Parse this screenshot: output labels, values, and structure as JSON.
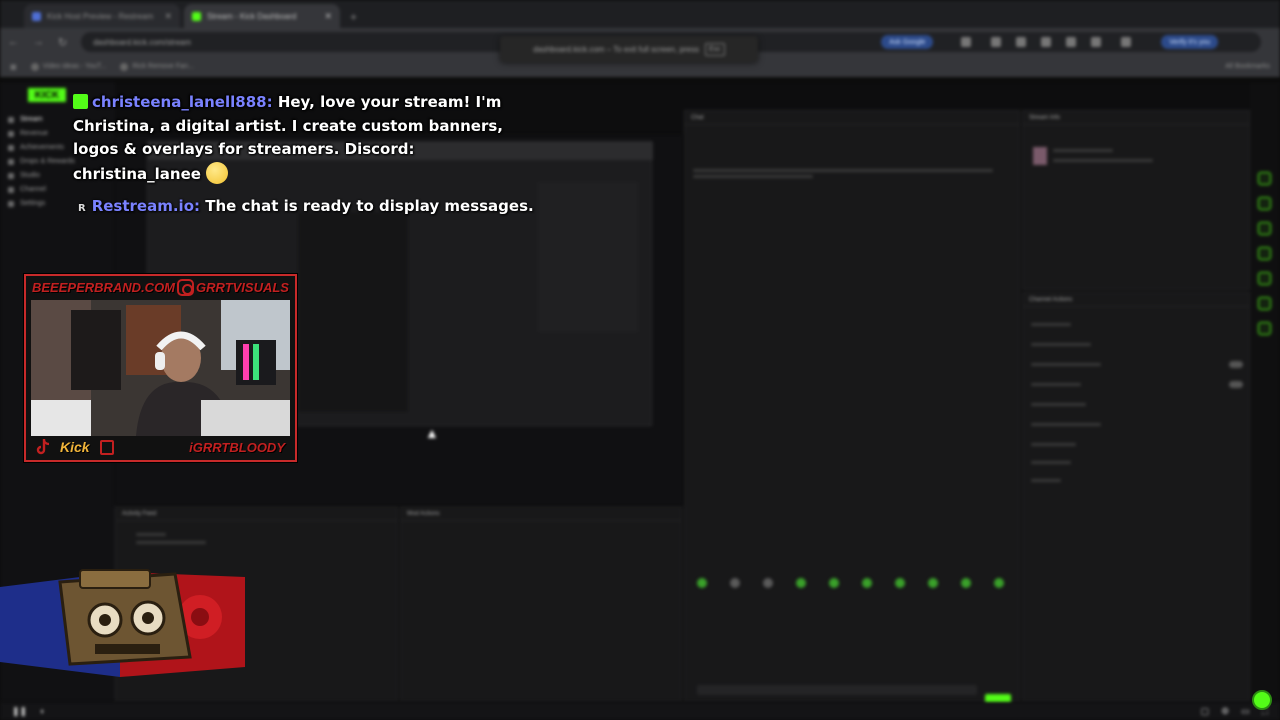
{
  "browser": {
    "tabs": [
      {
        "title": "Kick Host Preview - Restream",
        "active": false
      },
      {
        "title": "Stream - Kick Dashboard",
        "active": true
      }
    ],
    "url": "dashboard.kick.com/stream",
    "fullscreen_notice": "dashboard.kick.com – To exit full screen, press",
    "fullscreen_key": "Esc",
    "ask_google": "Ask Google",
    "profile": "Verify it's you",
    "bookmarks": [
      "Video ideas - YouT...",
      "Rick Remove Fan..."
    ],
    "all_bookmarks": "All Bookmarks"
  },
  "dashboard": {
    "logo": "KICK",
    "nav": [
      "Stream",
      "Revenue",
      "Achievements",
      "Drops & Rewards",
      "Studio",
      "Channel",
      "Settings"
    ],
    "panels": {
      "chat": "Chat",
      "stream_info": "Stream Info",
      "activity_feed": "Activity Feed",
      "mod_actions": "Mod Actions",
      "channel_actions": "Channel Actions"
    },
    "filter": "Filter"
  },
  "chat_overlay": {
    "message1": {
      "username": "christeena_lanell888:",
      "text_lines": [
        "Hey, love your stream! I'm",
        "Christina, a digital artist. I create custom banners,",
        "logos & overlays for streamers. Discord:",
        "christina_lanee"
      ]
    },
    "message2": {
      "badge": "R",
      "username": "Restream.io:",
      "text": "The chat is ready to display messages."
    }
  },
  "webcam_frame": {
    "top_left": "BEEEPERBRAND.COM",
    "top_right": "GRRTVISUALS",
    "bottom_platform": "Kick",
    "bottom_handle": "iGRRTBLOODY"
  },
  "colors": {
    "kick_green": "#53fc18",
    "username_blue": "#7a82ff",
    "frame_red": "#c82a2a",
    "kick_orange": "#f0b43a"
  }
}
